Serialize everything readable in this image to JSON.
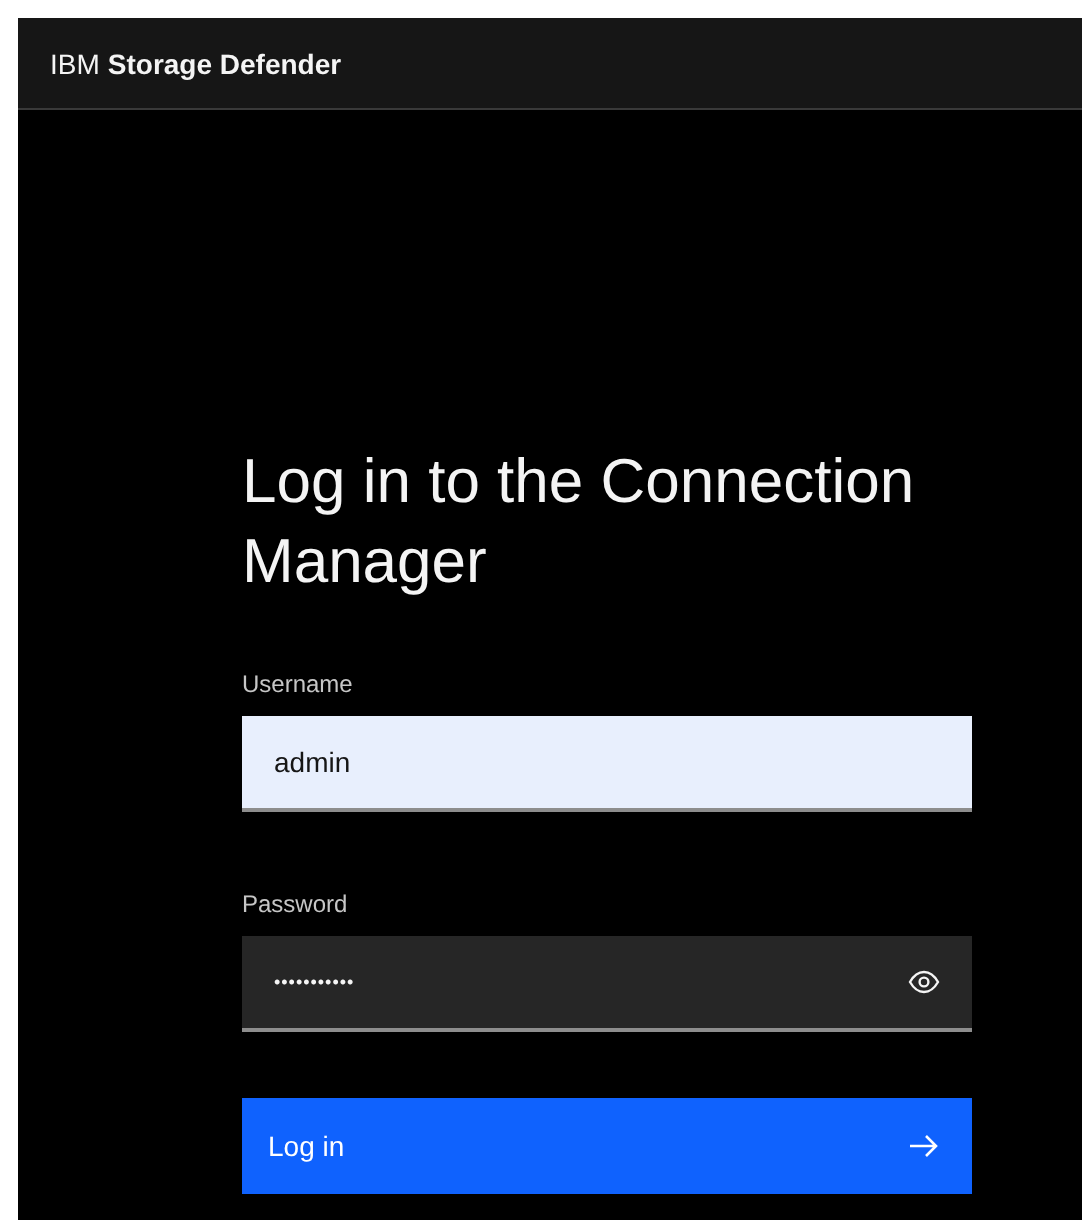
{
  "header": {
    "brand": "IBM",
    "product": "Storage Defender"
  },
  "form": {
    "title": "Log in to the Connection Manager",
    "fields": [
      {
        "label": "Username",
        "value": "admin",
        "kind": "text"
      },
      {
        "label": "Password",
        "value": "•••••••••••",
        "kind": "password"
      }
    ],
    "submit": "Log in"
  }
}
